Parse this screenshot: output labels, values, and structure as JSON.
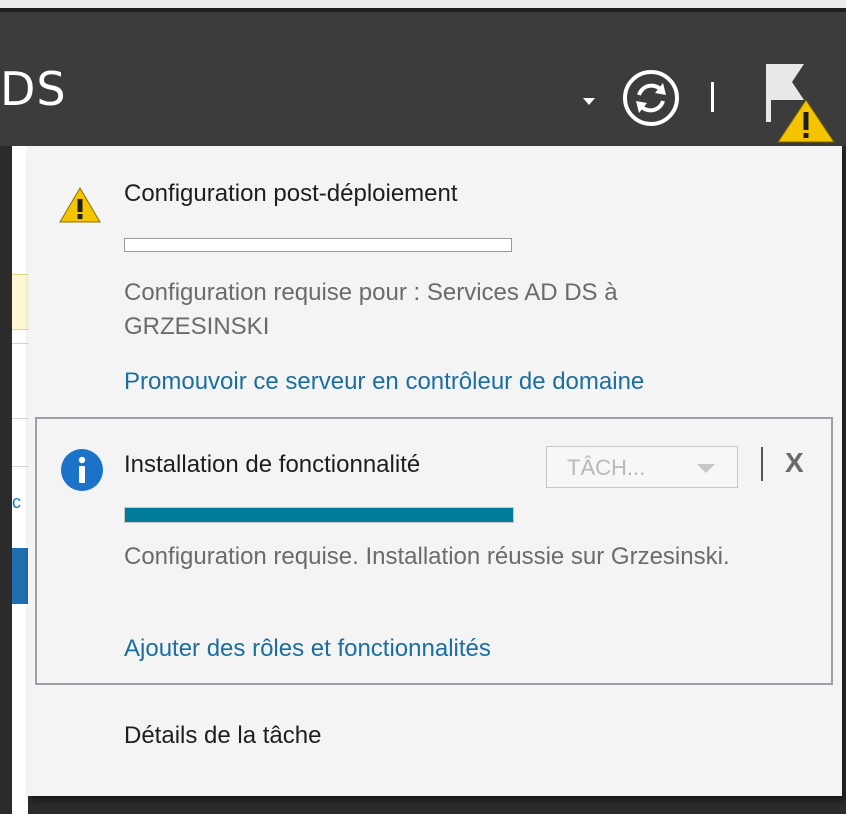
{
  "header": {
    "title_fragment": "DS",
    "icons": [
      "chevron-down-icon",
      "refresh-icon",
      "separator",
      "notification-flag-warning-icon"
    ]
  },
  "background": {
    "link_fragment": "c"
  },
  "notifications": [
    {
      "icon": "warning-icon",
      "title": "Configuration post-déploiement",
      "progress": 0,
      "description": "Configuration requise pour : Services AD DS à GRZESINSKI",
      "link": "Promouvoir ce serveur en contrôleur de domaine"
    },
    {
      "icon": "info-icon",
      "title": "Installation de fonctionnalité",
      "tasks_label": "TÂCH...",
      "close_label": "X",
      "progress": 1.0,
      "description": "Configuration requise. Installation réussie sur Grzesinski.",
      "link": "Ajouter des rôles et fonctionnalités"
    }
  ],
  "footer": {
    "task_details": "Détails de la tâche"
  },
  "colors": {
    "header_bg": "#3c3c3c",
    "link": "#1a6fa0",
    "progress_fill": "#007a99",
    "warning": "#f5c400",
    "info": "#1a73c9"
  }
}
